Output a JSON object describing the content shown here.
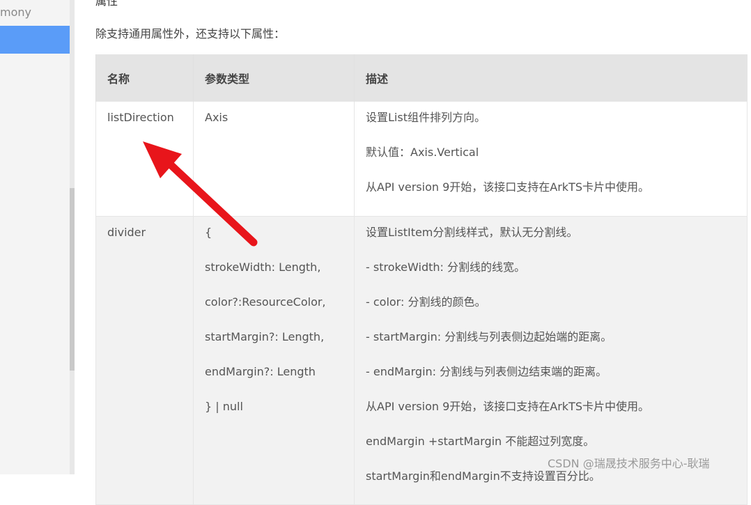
{
  "sidebar": {
    "partial_text": "mony"
  },
  "content": {
    "top_partial_heading": "属性",
    "intro": "除支持通用属性外，还支持以下属性："
  },
  "table": {
    "headers": [
      "名称",
      "参数类型",
      "描述"
    ],
    "rows": [
      {
        "name": "listDirection",
        "type": [
          "Axis"
        ],
        "desc": [
          "设置List组件排列方向。",
          "默认值：Axis.Vertical",
          "从API version 9开始，该接口支持在ArkTS卡片中使用。"
        ]
      },
      {
        "name": "divider",
        "type": [
          "{",
          "strokeWidth: Length,",
          "color?:ResourceColor,",
          "startMargin?: Length,",
          "endMargin?: Length",
          "} | null"
        ],
        "desc": [
          "设置ListItem分割线样式，默认无分割线。",
          "- strokeWidth: 分割线的线宽。",
          "- color: 分割线的颜色。",
          "- startMargin: 分割线与列表侧边起始端的距离。",
          "- endMargin: 分割线与列表侧边结束端的距离。",
          "从API version 9开始，该接口支持在ArkTS卡片中使用。",
          "endMargin +startMargin 不能超过列宽度。",
          "startMargin和endMargin不支持设置百分比。"
        ]
      }
    ]
  },
  "watermark": "CSDN @瑞晟技术服务中心-耿瑞",
  "colors": {
    "arrow": "#e8151b",
    "sidebar_active": "#5a9cf8"
  }
}
